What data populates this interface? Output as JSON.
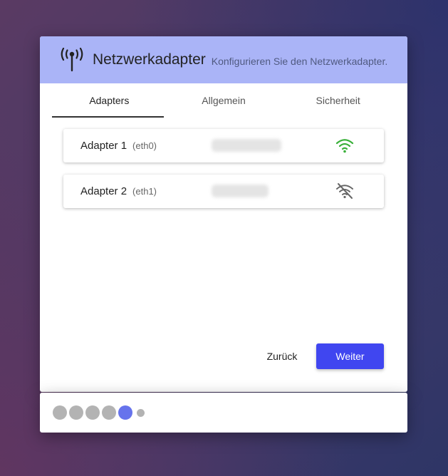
{
  "header": {
    "title": "Netzwerkadapter",
    "subtitle": "Konfigurieren Sie den Netzwerkadapter.",
    "icon": "antenna-icon",
    "background": "#aab4f7"
  },
  "tabs": [
    {
      "label": "Adapters",
      "active": true
    },
    {
      "label": "Allgemein",
      "active": false
    },
    {
      "label": "Sicherheit",
      "active": false
    }
  ],
  "adapters": [
    {
      "name": "Adapter 1",
      "interface": "(eth0)",
      "status": "connected",
      "icon": "wifi-icon",
      "color": "#3ab03a"
    },
    {
      "name": "Adapter 2",
      "interface": "(eth1)",
      "status": "disconnected",
      "icon": "wifi-off-icon",
      "color": "#666666"
    }
  ],
  "buttons": {
    "back_label": "Zurück",
    "next_label": "Weiter",
    "accent": "#4046f0"
  },
  "progress": {
    "total_steps": 6,
    "current_step": 5,
    "active_color": "#6673ec",
    "inactive_color": "#b3b3b3"
  }
}
